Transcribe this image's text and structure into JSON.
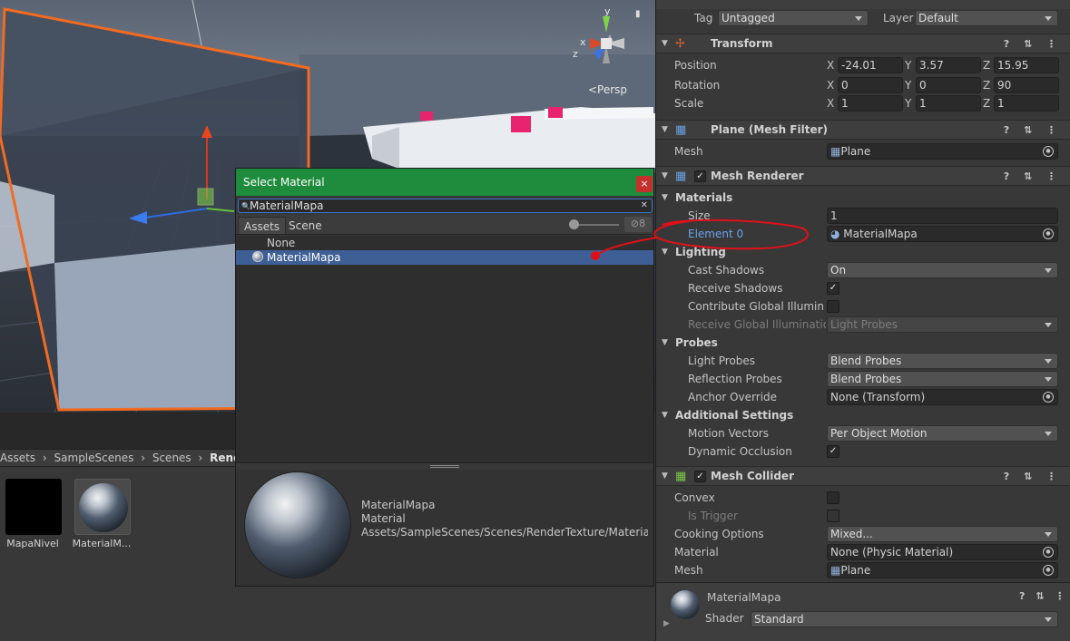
{
  "scene": {
    "persp_label": "<Persp",
    "gizmo_axes": {
      "x": "x",
      "y": "y",
      "z": "z"
    }
  },
  "project": {
    "breadcrumb": [
      "Assets",
      "SampleScenes",
      "Scenes",
      "RenderT"
    ],
    "breadcrumb_sep": "›",
    "assets": [
      {
        "name": "MapaNivel",
        "type": "render-texture"
      },
      {
        "name": "MaterialM...",
        "type": "material"
      }
    ]
  },
  "dialog": {
    "title": "Select Material",
    "close_icon": "×",
    "search_value": "MaterialMapa",
    "tabs": [
      "Assets",
      "Scene"
    ],
    "visibility_count": "8",
    "items": [
      {
        "label": "None",
        "selected": false
      },
      {
        "label": "MaterialMapa",
        "selected": true
      }
    ],
    "preview": {
      "name": "MaterialMapa",
      "type": "Material",
      "path": "Assets/SampleScenes/Scenes/RenderTexture/MaterialM"
    }
  },
  "inspector": {
    "tag_label": "Tag",
    "tag_value": "Untagged",
    "layer_label": "Layer",
    "layer_value": "Default",
    "transform": {
      "title": "Transform",
      "position_label": "Position",
      "rotation_label": "Rotation",
      "scale_label": "Scale",
      "position": {
        "x": "-24.01",
        "y": "3.57",
        "z": "15.95"
      },
      "rotation": {
        "x": "0",
        "y": "0",
        "z": "90"
      },
      "scale": {
        "x": "1",
        "y": "1",
        "z": "1"
      }
    },
    "mesh_filter": {
      "title": "Plane (Mesh Filter)",
      "mesh_label": "Mesh",
      "mesh_value": "Plane"
    },
    "mesh_renderer": {
      "title": "Mesh Renderer",
      "materials_label": "Materials",
      "size_label": "Size",
      "size_value": "1",
      "element0_label": "Element 0",
      "element0_value": "MaterialMapa",
      "lighting_label": "Lighting",
      "cast_shadows_label": "Cast Shadows",
      "cast_shadows_value": "On",
      "receive_shadows_label": "Receive Shadows",
      "receive_shadows_checked": true,
      "contribute_gi_label": "Contribute Global Illuminati",
      "contribute_gi_checked": false,
      "receive_gi_label": "Receive Global Illumination",
      "receive_gi_value": "Light Probes",
      "probes_label": "Probes",
      "light_probes_label": "Light Probes",
      "light_probes_value": "Blend Probes",
      "reflection_probes_label": "Reflection Probes",
      "reflection_probes_value": "Blend Probes",
      "anchor_override_label": "Anchor Override",
      "anchor_override_value": "None (Transform)",
      "additional_label": "Additional Settings",
      "motion_vectors_label": "Motion Vectors",
      "motion_vectors_value": "Per Object Motion",
      "dynamic_occlusion_label": "Dynamic Occlusion",
      "dynamic_occlusion_checked": true
    },
    "mesh_collider": {
      "title": "Mesh Collider",
      "convex_label": "Convex",
      "convex_checked": false,
      "is_trigger_label": "Is Trigger",
      "cooking_label": "Cooking Options",
      "cooking_value": "Mixed...",
      "material_label": "Material",
      "material_value": "None (Physic Material)",
      "mesh_label": "Mesh",
      "mesh_value": "Plane"
    },
    "material_footer": {
      "name": "MaterialMapa",
      "shader_label": "Shader",
      "shader_value": "Standard"
    },
    "checkmark": "✓",
    "header_tools": "? ⇅ ⋮"
  },
  "colors": {
    "dialog_title_bg": "#1e8c3c",
    "selection": "#3e5f96",
    "selection_outline": "#f26b21",
    "annotation_red": "#e0101a",
    "link_blue": "#6aa4f0"
  }
}
